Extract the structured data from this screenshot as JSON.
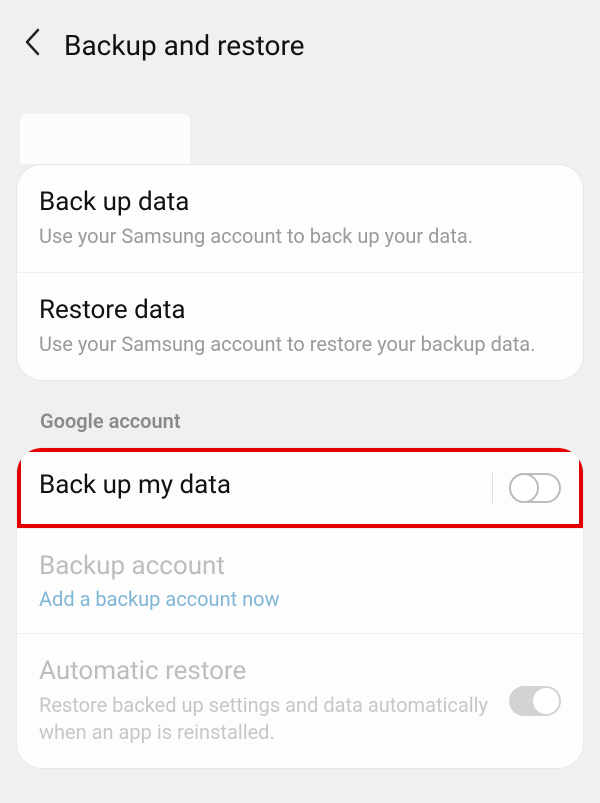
{
  "header": {
    "title": "Backup and restore"
  },
  "samsung_section": {
    "backup": {
      "title": "Back up data",
      "desc": "Use your Samsung account to back up your data."
    },
    "restore": {
      "title": "Restore data",
      "desc": "Use your Samsung account to restore your backup data."
    }
  },
  "google_section": {
    "header": "Google account",
    "backup_my_data": {
      "title": "Back up my data"
    },
    "backup_account": {
      "title": "Backup account",
      "link": "Add a backup account now"
    },
    "automatic_restore": {
      "title": "Automatic restore",
      "desc": "Restore backed up settings and data automatically when an app is reinstalled."
    }
  }
}
